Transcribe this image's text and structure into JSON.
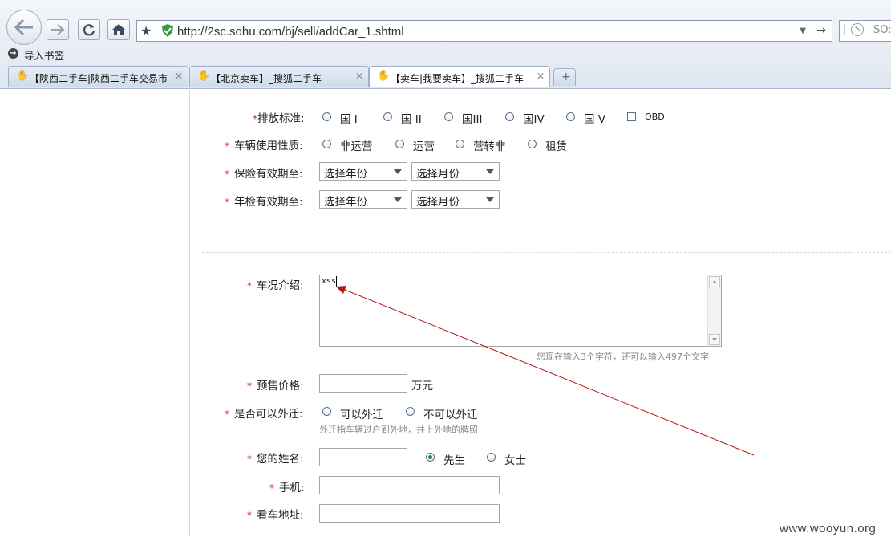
{
  "browser": {
    "url": "http://2sc.sohu.com/bj/sell/addCar_1.shtml",
    "search_placeholder": "SO:",
    "bookmark_label": "导入书签",
    "tabs": [
      {
        "label": "【陕西二手车|陕西二手车交易市"
      },
      {
        "label": "【北京卖车】_搜狐二手车"
      },
      {
        "label": "【卖车|我要卖车】_搜狐二手车"
      }
    ],
    "new_tab_label": "+"
  },
  "form": {
    "emission": {
      "label": "排放标准:",
      "options": [
        "国 I",
        "国 II",
        "国III",
        "国IV",
        "国 V"
      ],
      "checkbox_label": "OBD"
    },
    "usage": {
      "label": "车辆使用性质:",
      "options": [
        "非运营",
        "运营",
        "营转非",
        "租赁"
      ]
    },
    "insurance": {
      "label": "保险有效期至:",
      "year": "选择年份",
      "month": "选择月份"
    },
    "inspection": {
      "label": "年检有效期至:",
      "year": "选择年份",
      "month": "选择月份"
    },
    "description": {
      "label": "车况介绍:",
      "value": "xss",
      "counter": "您现在输入3个字符，还可以输入497个文字"
    },
    "price": {
      "label": "预售价格:",
      "value": "",
      "unit": "万元"
    },
    "transfer": {
      "label": "是否可以外迁:",
      "options": [
        "可以外迁",
        "不可以外迁"
      ],
      "hint": "外迁指车辆过户到外地，并上外地的牌照"
    },
    "name": {
      "label": "您的姓名:",
      "value": "",
      "options": [
        "先生",
        "女士"
      ],
      "selected": "先生"
    },
    "phone": {
      "label": "手机:",
      "value": ""
    },
    "address": {
      "label": "看车地址:",
      "value": ""
    },
    "required_mark": "*"
  },
  "annotation": {
    "arrow_color": "#b01818"
  },
  "watermark": "www.wooyun.org"
}
